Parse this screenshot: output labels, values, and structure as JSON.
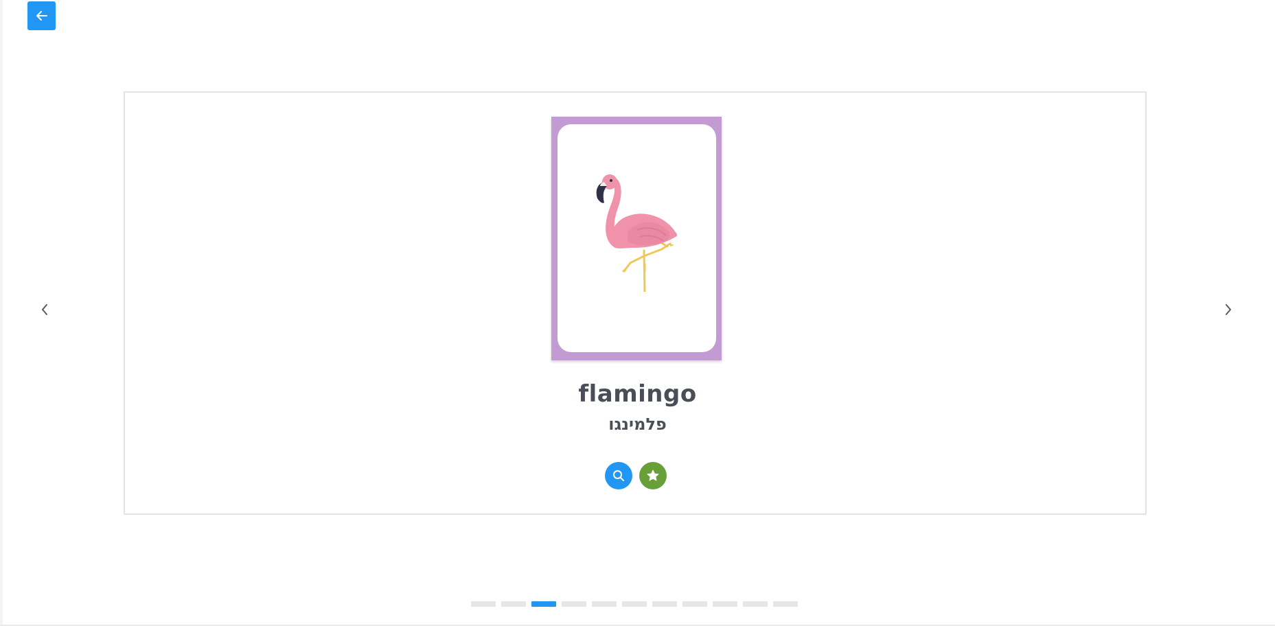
{
  "card": {
    "word_en": "flamingo",
    "word_he": "פלמינגו",
    "frame_color": "#c39bd3",
    "image_subject": "flamingo"
  },
  "icons": {
    "back": "arrow-left-icon",
    "prev": "chevron-left-icon",
    "next": "chevron-right-icon",
    "search": "search-icon",
    "favorite": "star-icon"
  },
  "colors": {
    "primary": "#2196f3",
    "success": "#689f38",
    "text": "#4a4e56",
    "inactive_dot": "#e4e7ea"
  },
  "pagination": {
    "total": 11,
    "active_index": 2
  }
}
